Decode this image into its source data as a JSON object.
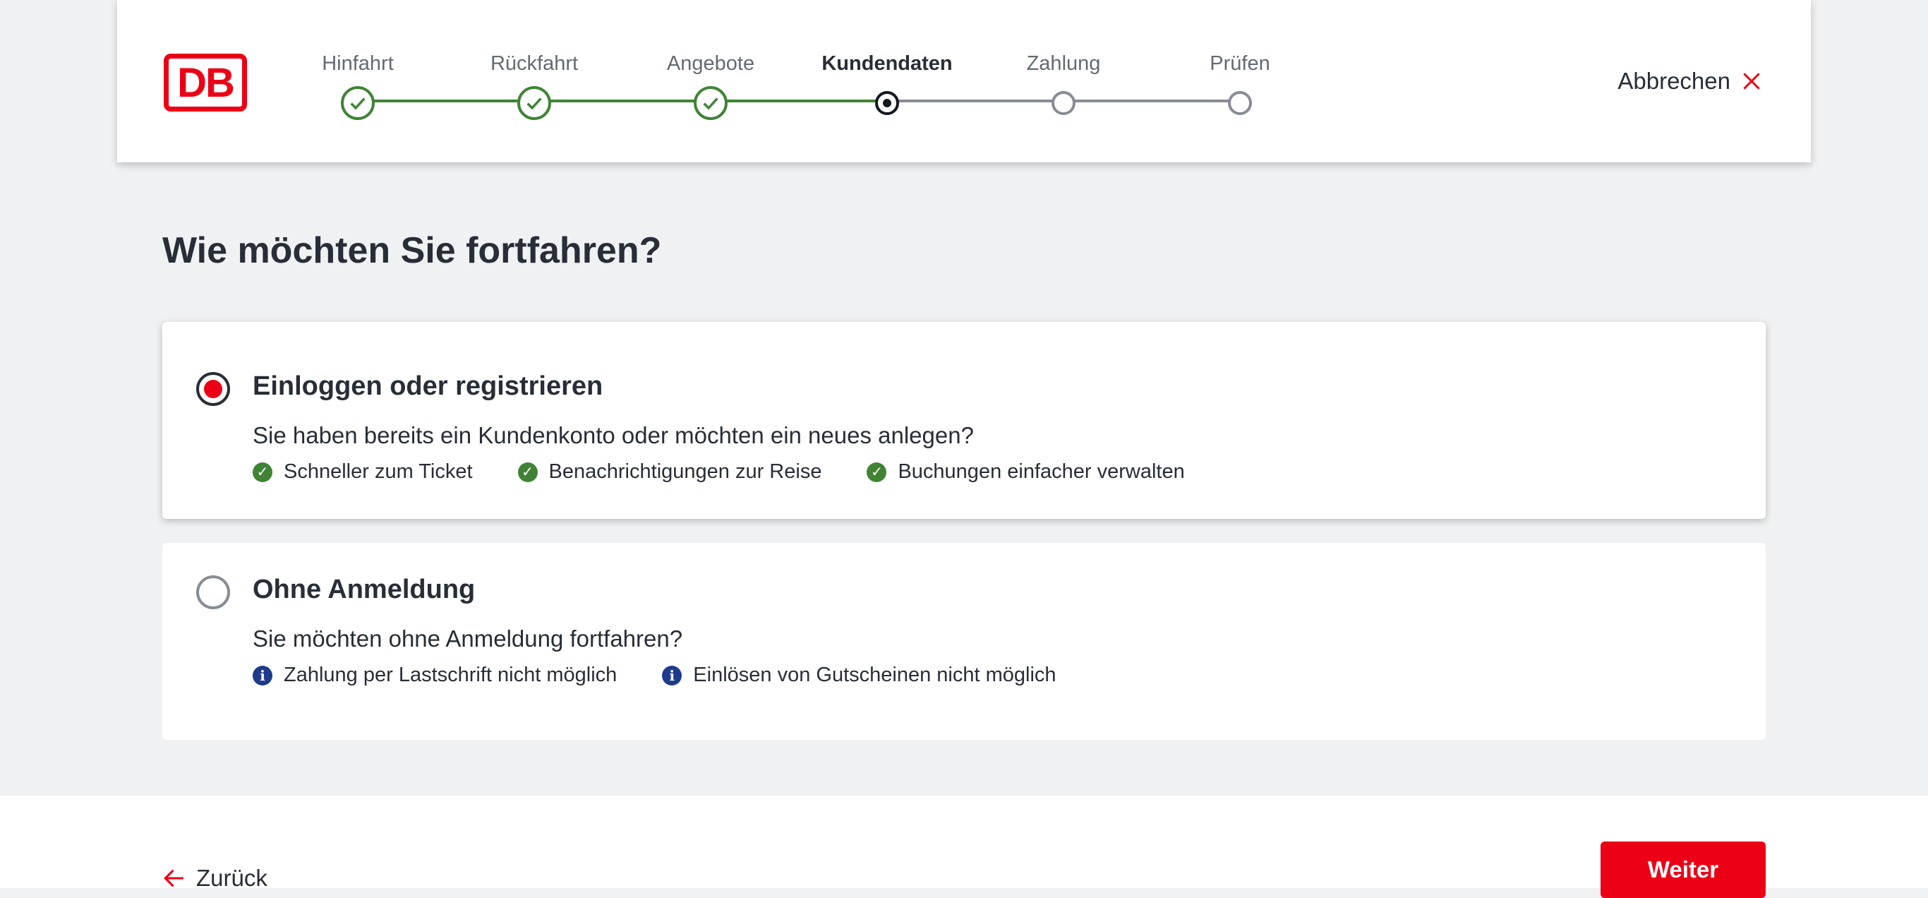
{
  "header": {
    "logo_text": "DB",
    "cancel_label": "Abbrechen",
    "steps": [
      {
        "label": "Hinfahrt",
        "state": "done"
      },
      {
        "label": "Rückfahrt",
        "state": "done"
      },
      {
        "label": "Angebote",
        "state": "done"
      },
      {
        "label": "Kundendaten",
        "state": "current"
      },
      {
        "label": "Zahlung",
        "state": "todo"
      },
      {
        "label": "Prüfen",
        "state": "todo"
      }
    ]
  },
  "main": {
    "title": "Wie möchten Sie fortfahren?",
    "options": [
      {
        "title": "Einloggen oder registrieren",
        "description": "Sie haben bereits ein Kundenkonto oder möchten ein neues anlegen?",
        "selected": true,
        "features": [
          {
            "icon": "check-circle-icon",
            "text": "Schneller zum Ticket"
          },
          {
            "icon": "check-circle-icon",
            "text": "Benachrichtigungen zur Reise"
          },
          {
            "icon": "check-circle-icon",
            "text": "Buchungen einfacher verwalten"
          }
        ]
      },
      {
        "title": "Ohne Anmeldung",
        "description": "Sie möchten ohne Anmeldung fortfahren?",
        "selected": false,
        "features": [
          {
            "icon": "info-circle-icon",
            "text": "Zahlung per Lastschrift nicht möglich"
          },
          {
            "icon": "info-circle-icon",
            "text": "Einlösen von Gutscheinen nicht möglich"
          }
        ]
      }
    ]
  },
  "footer": {
    "back_label": "Zurück",
    "next_label": "Weiter"
  },
  "colors": {
    "brand_red": "#ec0016",
    "success_green": "#408335",
    "info_blue": "#1e3a8a",
    "text": "#282d37",
    "inactive": "#878c96"
  }
}
